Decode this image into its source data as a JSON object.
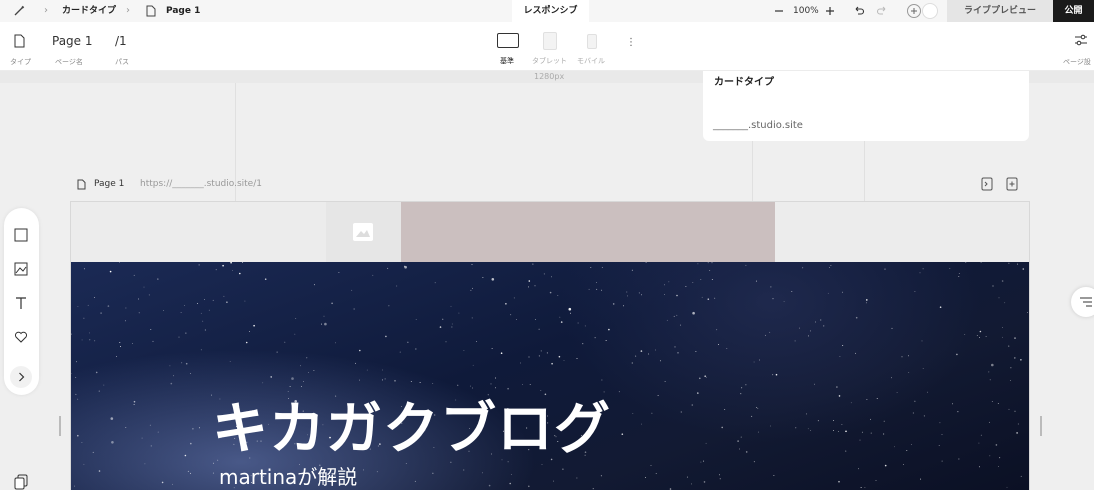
{
  "topbar": {
    "breadcrumb_card_type": "カードタイプ",
    "breadcrumb_page": "Page 1",
    "tab_responsive": "レスポンシブ",
    "zoom": "100%",
    "live_preview": "ライブプレビュー",
    "publish": "公開"
  },
  "pagebar": {
    "page_name": "Page 1",
    "path": "/1",
    "type_label": "タイプ",
    "page_name_label": "ページ名",
    "path_label": "パス",
    "device_base": "基準",
    "device_tablet": "タブレット",
    "device_mobile": "モバイル",
    "page_settings_label": "ページ設"
  },
  "ruler": {
    "width_label": "1280px"
  },
  "card_panel": {
    "title": "カードタイプ",
    "url": "_______.studio.site"
  },
  "page_row": {
    "page_label": "Page 1",
    "url": "https://_______.studio.site/1"
  },
  "hero": {
    "title": "キカガクブログ",
    "subtitle": "martinaが解説"
  },
  "icons": [
    "brush-icon",
    "chevron-right-icon",
    "page-icon",
    "minus-icon",
    "plus-icon",
    "undo-icon",
    "redo-icon",
    "add-circle-icon",
    "settings-sliders-icon",
    "more-icon",
    "image-icon",
    "box-icon",
    "text-icon",
    "heart-icon",
    "copy-icon",
    "list-icon"
  ],
  "colors": {
    "publish_bg": "#1a1a1a",
    "mauve_block": "#cbbfbf",
    "hero_bg": "#121a33"
  }
}
